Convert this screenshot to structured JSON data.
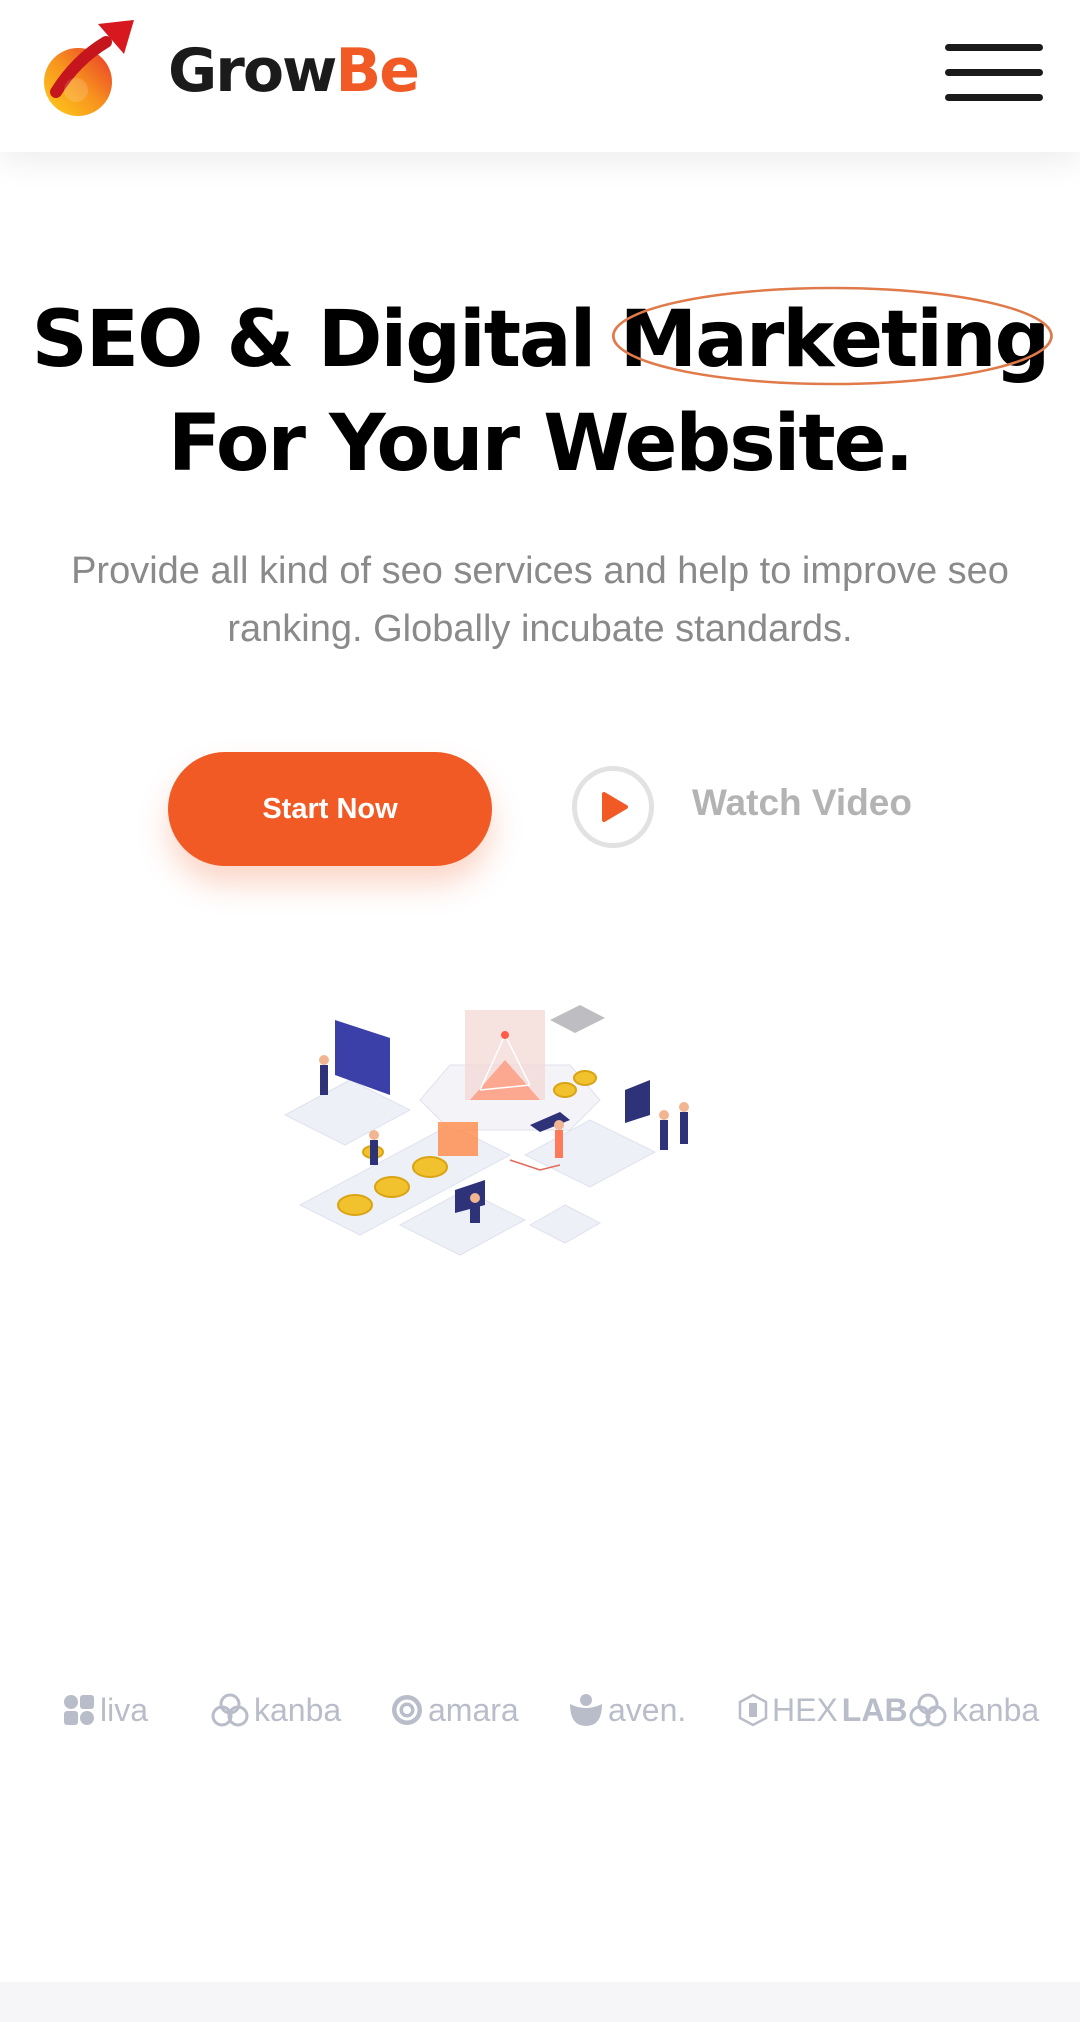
{
  "header": {
    "logo_part1": "Grow",
    "logo_part2": "Be",
    "menu_icon": "hamburger-menu-icon"
  },
  "hero": {
    "title_line1_prefix": "SEO & Digital ",
    "title_highlight": "Marketing",
    "title_line2": "For Your Website.",
    "subtitle": "Provide all kind of seo services and help to improve seo ranking. Globally incubate standards.",
    "start_button": "Start Now",
    "watch_video": "Watch Video",
    "play_icon": "play-icon"
  },
  "brands": [
    {
      "name": "liva",
      "icon": "liva-logo-icon"
    },
    {
      "name": "kanba",
      "icon": "kanba-logo-icon"
    },
    {
      "name": "amara",
      "icon": "amara-logo-icon"
    },
    {
      "name": "aven.",
      "icon": "aven-logo-icon"
    },
    {
      "name_part1": "HEX",
      "name_part2": "LAB",
      "icon": "hexlab-logo-icon"
    },
    {
      "name": "kanba",
      "icon": "kanba-logo-icon"
    }
  ],
  "colors": {
    "accent": "#f15a24",
    "brand_gray": "#b9bcc9",
    "subtitle_gray": "#8a8a8a"
  }
}
